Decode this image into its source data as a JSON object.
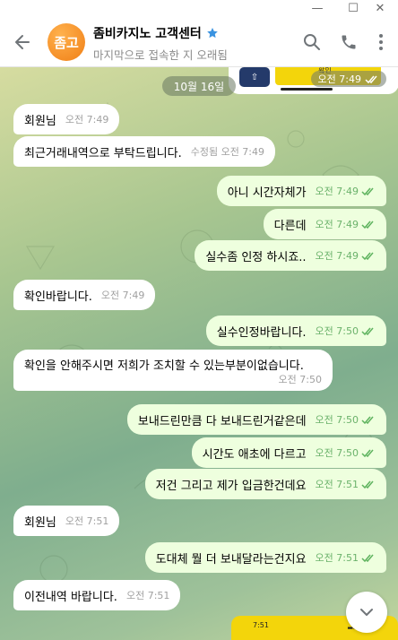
{
  "window": {
    "minimize_glyph": "—",
    "maximize_glyph": "☐",
    "close_glyph": "✕"
  },
  "header": {
    "avatar_text": "좀고",
    "title": "좀비카지노 고객센터",
    "status": "마지막으로 접속한 지 오래됨",
    "icons": [
      "back-arrow-icon",
      "search-icon",
      "phone-icon",
      "more-vert-icon",
      "verified-star-icon"
    ],
    "accent_color": "#3a93e0"
  },
  "chat": {
    "top_sticker": {
      "label": "확인",
      "time": "오전 7:49"
    },
    "date_divider": "10월 16일",
    "messages": [
      {
        "dir": "in",
        "text": "회원님",
        "time": "오전 7:49"
      },
      {
        "dir": "in",
        "text": "최근거래내역으로 부탁드립니다.",
        "time": "수정됨 오전 7:49"
      },
      {
        "dir": "out",
        "text": "아니 시간자체가",
        "time": "오전 7:49"
      },
      {
        "dir": "out",
        "text": "다른데",
        "time": "오전 7:49"
      },
      {
        "dir": "out",
        "text": "실수좀 인정 하시죠..",
        "time": "오전 7:49"
      },
      {
        "dir": "in",
        "text": "확인바랍니다.",
        "time": "오전 7:49"
      },
      {
        "dir": "out",
        "text": "실수인정바랍니다.",
        "time": "오전 7:50"
      },
      {
        "dir": "in",
        "text": "확인을 안해주시면 저희가 조치할 수 있는부분이없습니다.",
        "time": "오전 7:50"
      },
      {
        "dir": "out",
        "text": "보내드린만큼 다 보내드린거같은데",
        "time": "오전 7:50"
      },
      {
        "dir": "out",
        "text": "시간도 애초에 다르고",
        "time": "오전 7:50"
      },
      {
        "dir": "out",
        "text": "저건 그리고 제가 입금한건데요",
        "time": "오전 7:51"
      },
      {
        "dir": "in",
        "text": "회원님",
        "time": "오전 7:51"
      },
      {
        "dir": "out",
        "text": "도대체 뭘 더 보내달라는건지요",
        "time": "오전 7:51"
      },
      {
        "dir": "in",
        "text": "이전내역 바랍니다.",
        "time": "오전 7:51"
      }
    ],
    "bottom_sticker": {
      "time": "7:51"
    },
    "colors": {
      "outgoing_bubble": "#eeffde",
      "incoming_bubble": "#ffffff",
      "read_check": "#5fb35f"
    }
  }
}
